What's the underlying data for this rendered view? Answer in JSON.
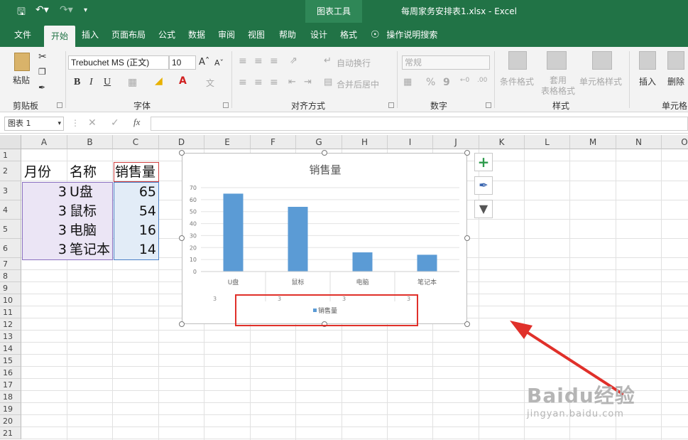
{
  "title_bar": {
    "context_tab": "图表工具",
    "doc_title": "每周家务安排表1.xlsx  -  Excel"
  },
  "tabs": [
    {
      "label": "文件"
    },
    {
      "label": "开始"
    },
    {
      "label": "插入"
    },
    {
      "label": "页面布局"
    },
    {
      "label": "公式"
    },
    {
      "label": "数据"
    },
    {
      "label": "审阅"
    },
    {
      "label": "视图"
    },
    {
      "label": "帮助"
    },
    {
      "label": "设计"
    },
    {
      "label": "格式"
    }
  ],
  "tell_me": "操作说明搜索",
  "ribbon": {
    "clipboard": {
      "paste": "粘贴",
      "label": "剪贴板"
    },
    "font": {
      "name": "Trebuchet MS (正文)",
      "size": "10",
      "bold": "B",
      "italic": "I",
      "underline": "U",
      "label": "字体"
    },
    "alignment": {
      "wrap": "自动换行",
      "merge": "合并后居中",
      "label": "对齐方式"
    },
    "number": {
      "format": "常规",
      "percent": "%",
      "comma": "9",
      "label": "数字"
    },
    "styles": {
      "conditional": "条件格式",
      "table_format": "套用\n表格格式",
      "cell_styles": "单元格样式",
      "label": "样式"
    },
    "cells": {
      "insert": "插入",
      "delete": "删除",
      "label": "单元格"
    }
  },
  "formula_bar": {
    "name_box": "图表 1",
    "fx": "fx"
  },
  "columns": [
    "A",
    "B",
    "C",
    "D",
    "E",
    "F",
    "G",
    "H",
    "I",
    "J",
    "K",
    "L",
    "M",
    "N",
    "O"
  ],
  "rows": [
    "1",
    "2",
    "3",
    "4",
    "5",
    "6",
    "7",
    "8",
    "9",
    "10",
    "11",
    "12",
    "13",
    "14",
    "15",
    "16",
    "17",
    "18",
    "19",
    "20",
    "21"
  ],
  "cells": {
    "A2": "月份",
    "B2": "名称",
    "C2": "销售量",
    "A3": "3",
    "B3": "U盘",
    "C3": "65",
    "A4": "3",
    "B4": "鼠标",
    "C4": "54",
    "A5": "3",
    "B5": "电脑",
    "C5": "16",
    "A6": "3",
    "B6": "笔记本",
    "C6": "14"
  },
  "chart_data": {
    "type": "bar",
    "title": "销售量",
    "categories": [
      "U盘",
      "鼠标",
      "电脑",
      "笔记本"
    ],
    "secondary_categories": [
      "3",
      "3",
      "3",
      "3"
    ],
    "series": [
      {
        "name": "销售量",
        "values": [
          65,
          54,
          16,
          14
        ],
        "color": "#5b9bd5"
      }
    ],
    "ylim": [
      0,
      70
    ],
    "yticks": [
      0,
      10,
      20,
      30,
      40,
      50,
      60,
      70
    ],
    "grid": true,
    "legend": "bottom"
  },
  "chart_buttons": [
    {
      "icon": "plus-icon"
    },
    {
      "icon": "brush-icon"
    },
    {
      "icon": "filter-icon"
    }
  ],
  "watermark": {
    "line1": "Baidu经验",
    "line2": "jingyan.baidu.com"
  },
  "colors": {
    "excel_green": "#217346",
    "highlight_red": "#e0302a",
    "bar_blue": "#5b9bd5"
  }
}
